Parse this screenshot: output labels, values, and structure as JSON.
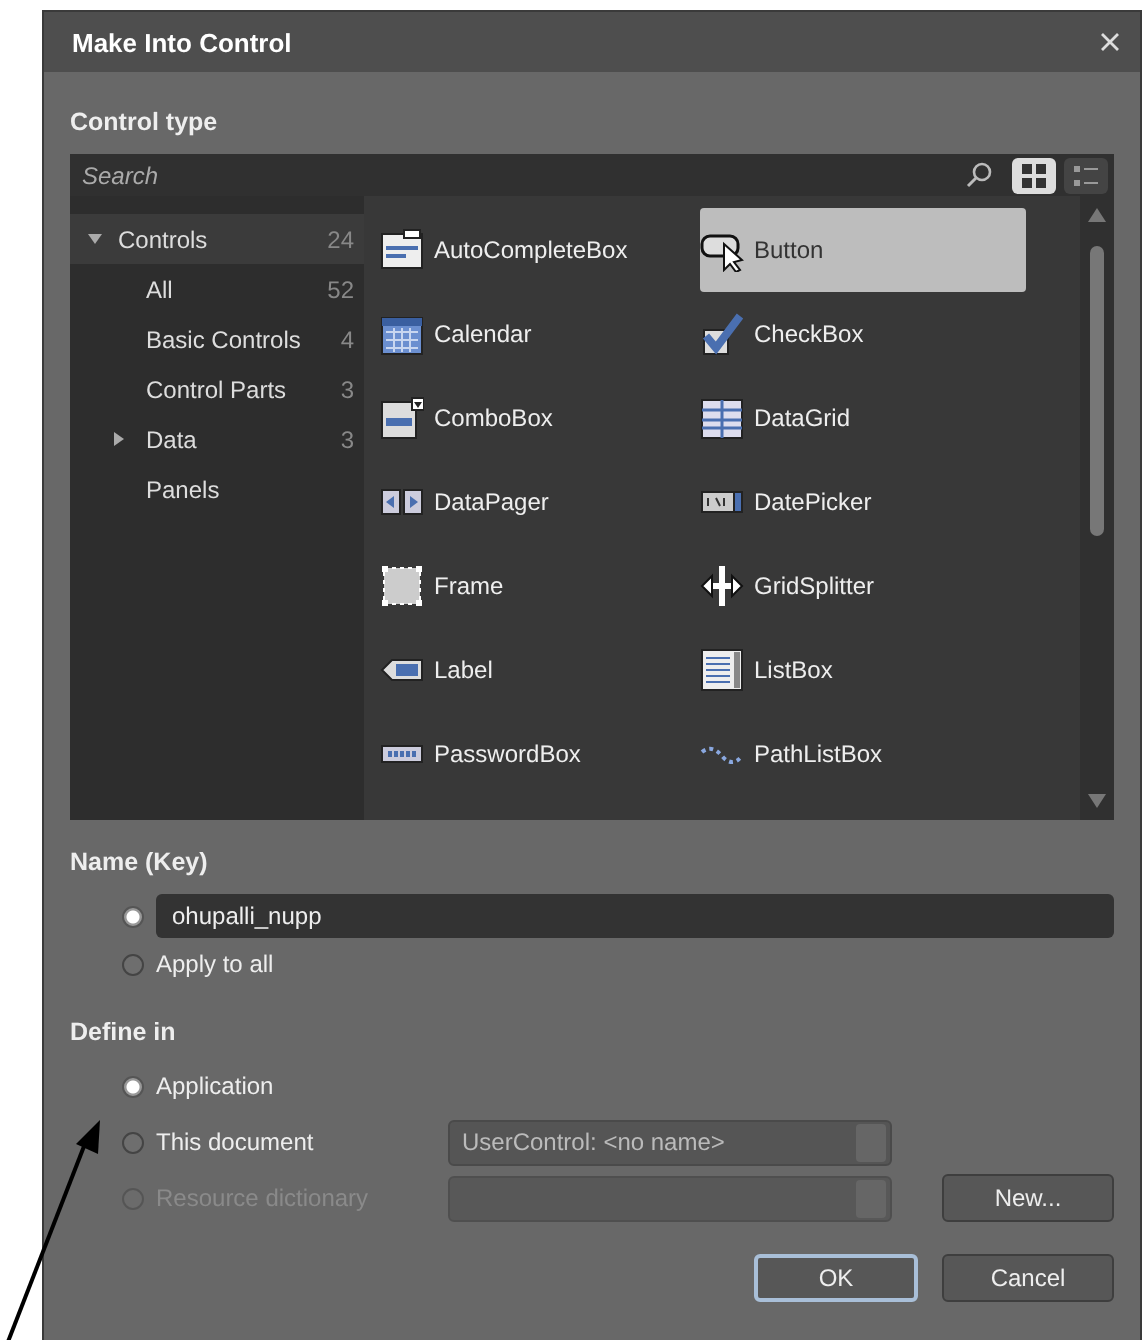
{
  "window": {
    "title": "Make Into Control"
  },
  "control_type": {
    "heading": "Control type",
    "search": {
      "placeholder": "Search"
    },
    "views": [
      {
        "kind": "grid",
        "selected": true
      },
      {
        "kind": "list",
        "selected": false
      }
    ],
    "tree": [
      {
        "kind": "group",
        "label": "Controls",
        "count": "24",
        "selected": true,
        "expanded": true,
        "children": [
          {
            "kind": "leaf",
            "label": "All",
            "count": "52",
            "selected": false
          },
          {
            "kind": "leaf",
            "label": "Basic Controls",
            "count": "4",
            "selected": false
          },
          {
            "kind": "leaf",
            "label": "Control Parts",
            "count": "3",
            "selected": false
          },
          {
            "kind": "group",
            "label": "Data",
            "count": "3",
            "selected": false,
            "expanded": false
          },
          {
            "kind": "leaf",
            "label": "Panels",
            "selected": false
          }
        ]
      }
    ],
    "items": [
      {
        "label": "AutoCompleteBox",
        "selected": false
      },
      {
        "label": "Button",
        "selected": true
      },
      {
        "label": "Calendar",
        "selected": false
      },
      {
        "label": "CheckBox",
        "selected": false
      },
      {
        "label": "ComboBox",
        "selected": false
      },
      {
        "label": "DataGrid",
        "selected": false
      },
      {
        "label": "DataPager",
        "selected": false
      },
      {
        "label": "DatePicker",
        "selected": false
      },
      {
        "label": "Frame",
        "selected": false
      },
      {
        "label": "GridSplitter",
        "selected": false
      },
      {
        "label": "Label",
        "selected": false
      },
      {
        "label": "ListBox",
        "selected": false
      },
      {
        "label": "PasswordBox",
        "selected": false
      },
      {
        "label": "PathListBox",
        "selected": false
      }
    ]
  },
  "name_key": {
    "heading": "Name (Key)",
    "options": [
      {
        "kind": "field",
        "selected": true,
        "value": "ohupalli_nupp"
      },
      {
        "kind": "label",
        "selected": false,
        "label": "Apply to all"
      }
    ]
  },
  "define_in": {
    "heading": "Define in",
    "options": [
      {
        "kind": "plain",
        "label": "Application",
        "selected": true,
        "disabled": false
      },
      {
        "kind": "combo",
        "label": "This document",
        "selected": false,
        "disabled": false,
        "value": "UserControl: <no name>"
      },
      {
        "kind": "combo",
        "label": "Resource dictionary",
        "selected": false,
        "disabled": true
      }
    ],
    "new_button": "New..."
  },
  "buttons": [
    {
      "label": "OK",
      "default": true
    },
    {
      "label": "Cancel",
      "default": false
    }
  ]
}
